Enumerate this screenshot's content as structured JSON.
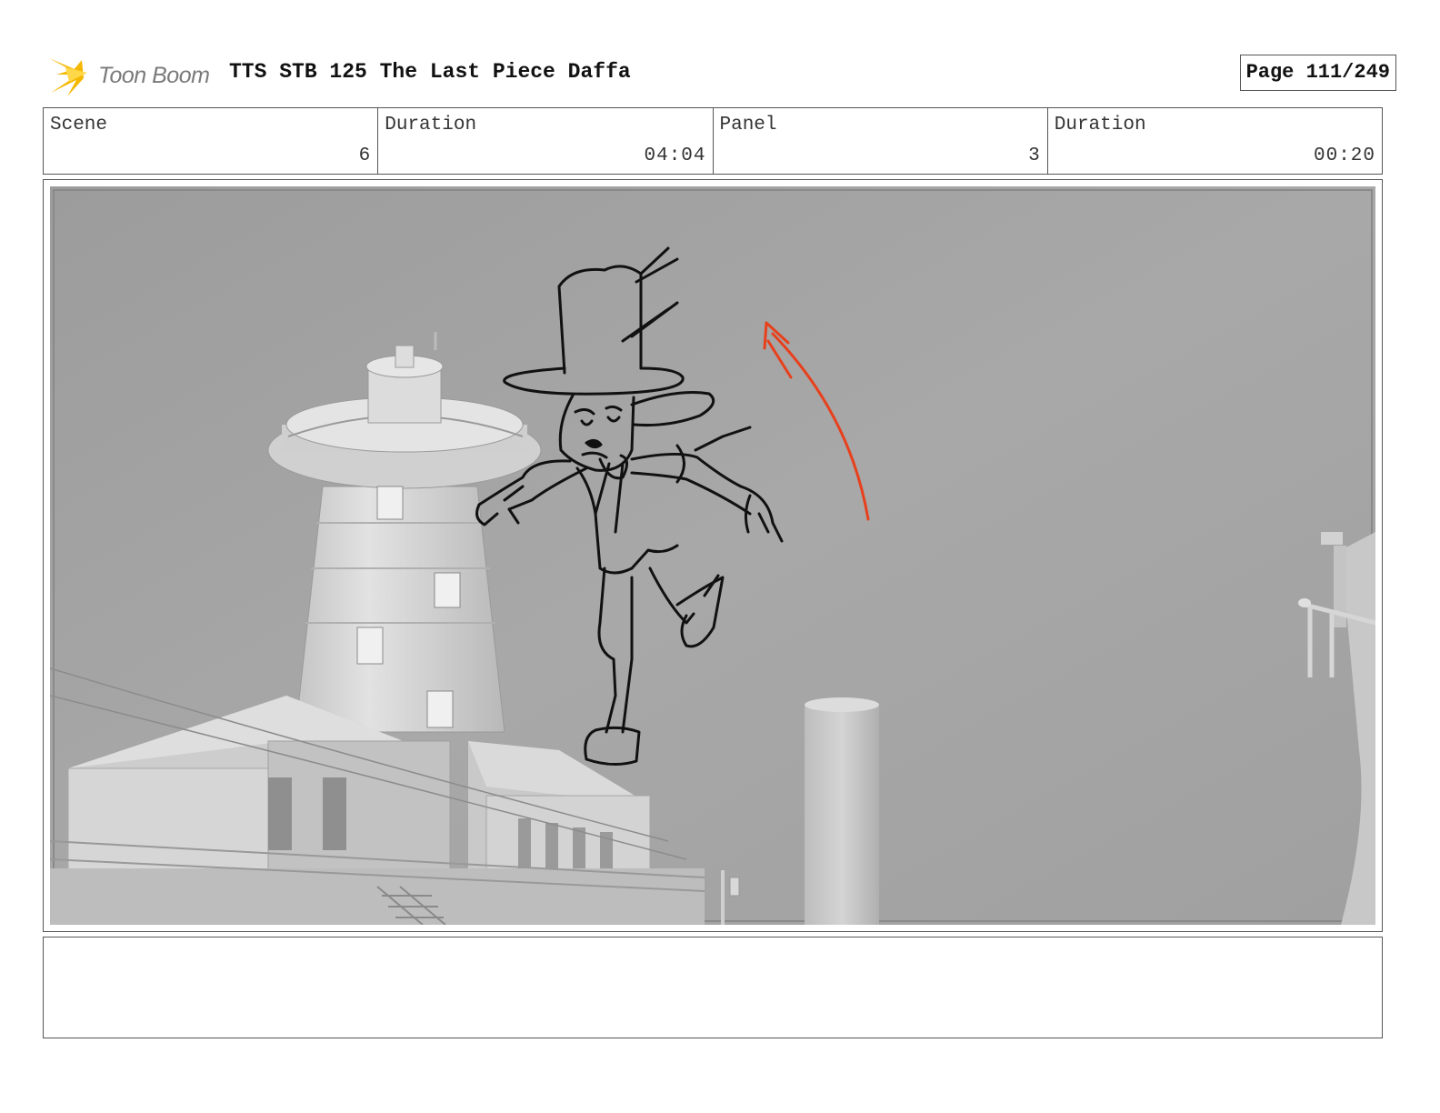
{
  "header": {
    "logo_text": "Toon Boom",
    "title": "TTS STB 125 The Last Piece Daffa",
    "page": "Page 111/249"
  },
  "info": [
    {
      "label": "Scene",
      "value": "6"
    },
    {
      "label": "Duration",
      "value": "04:04"
    },
    {
      "label": "Panel",
      "value": "3"
    },
    {
      "label": "Duration",
      "value": "00:20"
    }
  ],
  "panel": {
    "background_color": "#a3a3a3",
    "sketch_color": "#111111",
    "motion_arrow_color": "#e8401c"
  },
  "notes": {
    "text": ""
  },
  "colors": {
    "logo_accent": "#f5b800",
    "border": "#555555"
  }
}
